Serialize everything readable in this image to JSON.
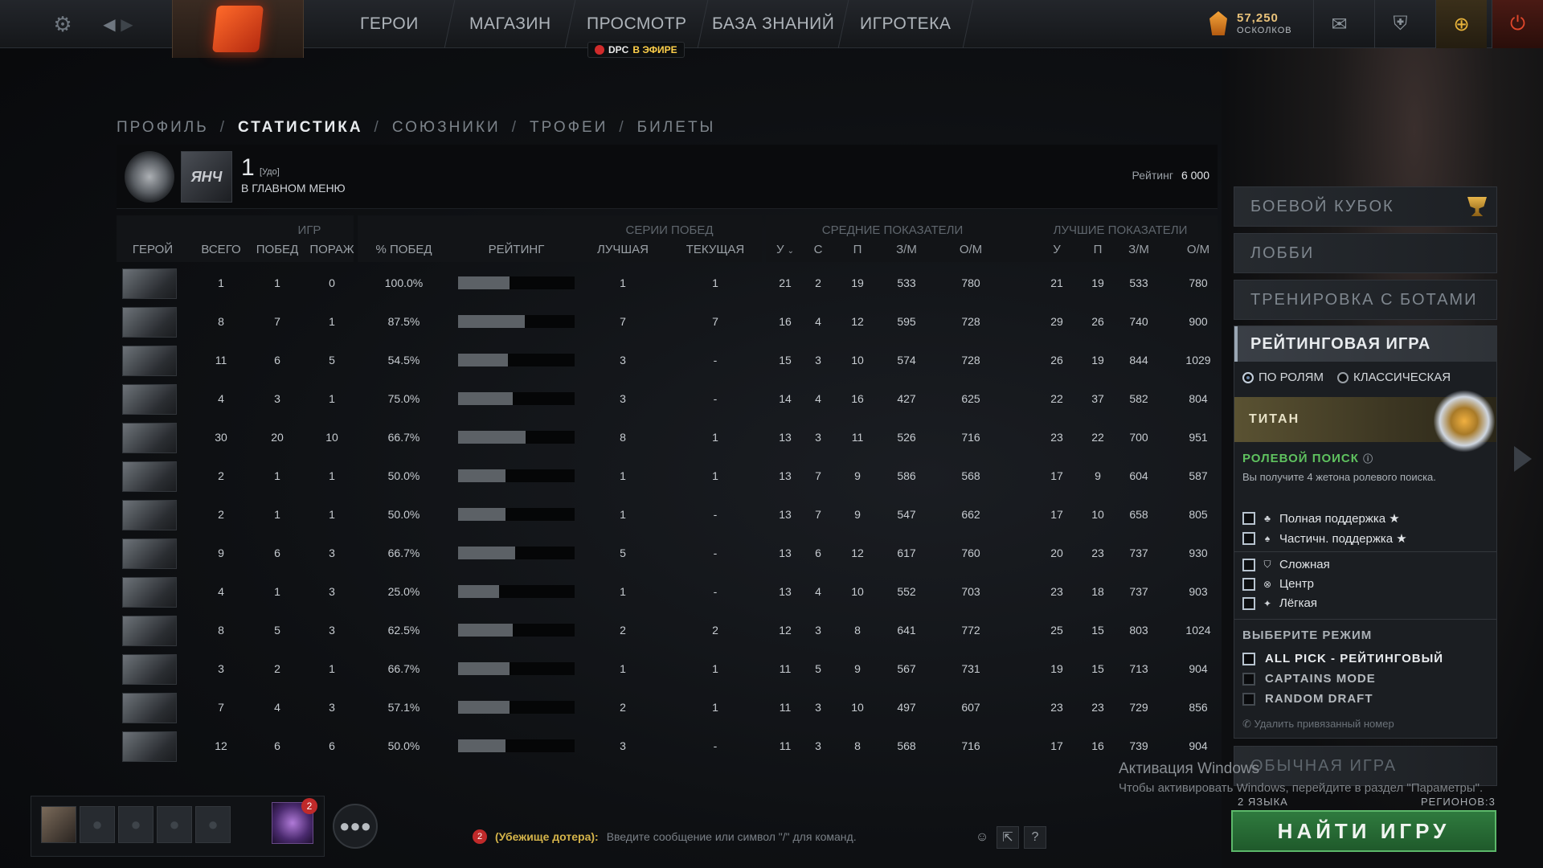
{
  "topbar": {
    "nav": [
      "ГЕРОИ",
      "МАГАЗИН",
      "ПРОСМОТР",
      "БАЗА ЗНАНИЙ",
      "ИГРОТЕКА"
    ],
    "live_prefix": "DPC",
    "live_text": "В ЭФИРЕ",
    "shards_value": "57,250",
    "shards_label": "ОСКОЛКОВ"
  },
  "breadcrumbs": {
    "items": [
      "ПРОФИЛЬ",
      "СТАТИСТИКА",
      "СОЮЗНИКИ",
      "ТРОФЕИ",
      "БИЛЕТЫ"
    ],
    "separator": "/"
  },
  "profile": {
    "avatar_text": "ЯНЧ",
    "name": "1",
    "tag": "[Удо]",
    "status": "В ГЛАВНОМ МЕНЮ",
    "rating_label": "Рейтинг",
    "rating_value": "6 000"
  },
  "table": {
    "group_headers": {
      "games": "ИГР",
      "streaks": "СЕРИИ ПОБЕД",
      "averages": "СРЕДНИЕ ПОКАЗАТЕЛИ",
      "best": "ЛУЧШИЕ ПОКАЗАТЕЛИ"
    },
    "columns": {
      "hero": "ГЕРОЙ",
      "total": "ВСЕГО",
      "wins": "ПОБЕД",
      "losses": "ПОРАЖ",
      "winrate": "% ПОБЕД",
      "rating": "РЕЙТИНГ",
      "best_streak": "ЛУЧШАЯ",
      "current_streak": "ТЕКУЩАЯ",
      "avg_k": "У",
      "avg_d": "С",
      "avg_a": "П",
      "avg_gpm": "З/М",
      "avg_xpm": "О/М",
      "best_k": "У",
      "best_a": "П",
      "best_gpm": "З/М",
      "best_xpm": "О/М"
    },
    "rows": [
      {
        "total": "1",
        "wins": "1",
        "losses": "0",
        "winrate": "100.0%",
        "rating": 0.44,
        "best": "1",
        "cur": "1",
        "ak": "21",
        "ad": "2",
        "aa": "19",
        "agpm": "533",
        "axpm": "780",
        "bk": "21",
        "ba": "19",
        "bgpm": "533",
        "bxpm": "780"
      },
      {
        "total": "8",
        "wins": "7",
        "losses": "1",
        "winrate": "87.5%",
        "rating": 0.57,
        "best": "7",
        "cur": "7",
        "ak": "16",
        "ad": "4",
        "aa": "12",
        "agpm": "595",
        "axpm": "728",
        "bk": "29",
        "ba": "26",
        "bgpm": "740",
        "bxpm": "900"
      },
      {
        "total": "11",
        "wins": "6",
        "losses": "5",
        "winrate": "54.5%",
        "rating": 0.43,
        "best": "3",
        "cur": "-",
        "ak": "15",
        "ad": "3",
        "aa": "10",
        "agpm": "574",
        "axpm": "728",
        "bk": "26",
        "ba": "19",
        "bgpm": "844",
        "bxpm": "1029"
      },
      {
        "total": "4",
        "wins": "3",
        "losses": "1",
        "winrate": "75.0%",
        "rating": 0.47,
        "best": "3",
        "cur": "-",
        "ak": "14",
        "ad": "4",
        "aa": "16",
        "agpm": "427",
        "axpm": "625",
        "bk": "22",
        "ba": "37",
        "bgpm": "582",
        "bxpm": "804"
      },
      {
        "total": "30",
        "wins": "20",
        "losses": "10",
        "winrate": "66.7%",
        "rating": 0.58,
        "best": "8",
        "cur": "1",
        "ak": "13",
        "ad": "3",
        "aa": "11",
        "agpm": "526",
        "axpm": "716",
        "bk": "23",
        "ba": "22",
        "bgpm": "700",
        "bxpm": "951"
      },
      {
        "total": "2",
        "wins": "1",
        "losses": "1",
        "winrate": "50.0%",
        "rating": 0.41,
        "best": "1",
        "cur": "1",
        "ak": "13",
        "ad": "7",
        "aa": "9",
        "agpm": "586",
        "axpm": "568",
        "bk": "17",
        "ba": "9",
        "bgpm": "604",
        "bxpm": "587"
      },
      {
        "total": "2",
        "wins": "1",
        "losses": "1",
        "winrate": "50.0%",
        "rating": 0.41,
        "best": "1",
        "cur": "-",
        "ak": "13",
        "ad": "7",
        "aa": "9",
        "agpm": "547",
        "axpm": "662",
        "bk": "17",
        "ba": "10",
        "bgpm": "658",
        "bxpm": "805"
      },
      {
        "total": "9",
        "wins": "6",
        "losses": "3",
        "winrate": "66.7%",
        "rating": 0.49,
        "best": "5",
        "cur": "-",
        "ak": "13",
        "ad": "6",
        "aa": "12",
        "agpm": "617",
        "axpm": "760",
        "bk": "20",
        "ba": "23",
        "bgpm": "737",
        "bxpm": "930"
      },
      {
        "total": "4",
        "wins": "1",
        "losses": "3",
        "winrate": "25.0%",
        "rating": 0.35,
        "best": "1",
        "cur": "-",
        "ak": "13",
        "ad": "4",
        "aa": "10",
        "agpm": "552",
        "axpm": "703",
        "bk": "23",
        "ba": "18",
        "bgpm": "737",
        "bxpm": "903"
      },
      {
        "total": "8",
        "wins": "5",
        "losses": "3",
        "winrate": "62.5%",
        "rating": 0.47,
        "best": "2",
        "cur": "2",
        "ak": "12",
        "ad": "3",
        "aa": "8",
        "agpm": "641",
        "axpm": "772",
        "bk": "25",
        "ba": "15",
        "bgpm": "803",
        "bxpm": "1024"
      },
      {
        "total": "3",
        "wins": "2",
        "losses": "1",
        "winrate": "66.7%",
        "rating": 0.44,
        "best": "1",
        "cur": "1",
        "ak": "11",
        "ad": "5",
        "aa": "9",
        "agpm": "567",
        "axpm": "731",
        "bk": "19",
        "ba": "15",
        "bgpm": "713",
        "bxpm": "904"
      },
      {
        "total": "7",
        "wins": "4",
        "losses": "3",
        "winrate": "57.1%",
        "rating": 0.44,
        "best": "2",
        "cur": "1",
        "ak": "11",
        "ad": "3",
        "aa": "10",
        "agpm": "497",
        "axpm": "607",
        "bk": "23",
        "ba": "23",
        "bgpm": "729",
        "bxpm": "856"
      },
      {
        "total": "12",
        "wins": "6",
        "losses": "6",
        "winrate": "50.0%",
        "rating": 0.41,
        "best": "3",
        "cur": "-",
        "ak": "11",
        "ad": "3",
        "aa": "8",
        "agpm": "568",
        "axpm": "716",
        "bk": "17",
        "ba": "16",
        "bgpm": "739",
        "bxpm": "904"
      }
    ]
  },
  "right_panel": {
    "battle_cup": "БОЕВОЙ КУБОК",
    "lobby": "ЛОББИ",
    "bot_training": "ТРЕНИРОВКА С БОТАМИ",
    "ranked_title": "РЕЙТИНГОВАЯ ИГРА",
    "by_roles": "ПО РОЛЯМ",
    "classic": "КЛАССИЧЕСКАЯ",
    "rank_name": "ТИТАН",
    "role_search": "РОЛЕВОЙ ПОИСК",
    "role_sub": "Вы получите 4 жетона ролевого поиска.",
    "roles": [
      {
        "label": "Полная поддержка ★",
        "icon": "support-icon"
      },
      {
        "label": "Частичн. поддержка ★",
        "icon": "soft-support-icon"
      },
      {
        "label": "Сложная",
        "icon": "offlane-icon"
      },
      {
        "label": "Центр",
        "icon": "mid-icon"
      },
      {
        "label": "Лёгкая",
        "icon": "safelane-icon"
      }
    ],
    "mode_title": "ВЫБЕРИТЕ РЕЖИМ",
    "modes": [
      "ALL PICK - РЕЙТИНГОВЫЙ",
      "CAPTAINS MODE",
      "RANDOM DRAFT"
    ],
    "unlink_phone": "Удалить привязанный номер",
    "normal_game": "ОБЫЧНАЯ ИГРА",
    "languages": "2 ЯЗЫКА",
    "regions": "РЕГИОНОВ:3",
    "find_game": "НАЙТИ ИГРУ"
  },
  "windows": {
    "activation": "Активация Windows",
    "activation_sub": "Чтобы активировать Windows, перейдите в раздел \"Параметры\"."
  },
  "bottom": {
    "event_badge": "2",
    "chat_count": "2",
    "chat_channel": "(Убежище дотера):",
    "chat_placeholder": "Введите сообщение или символ \"/\" для команд.",
    "help": "?"
  }
}
